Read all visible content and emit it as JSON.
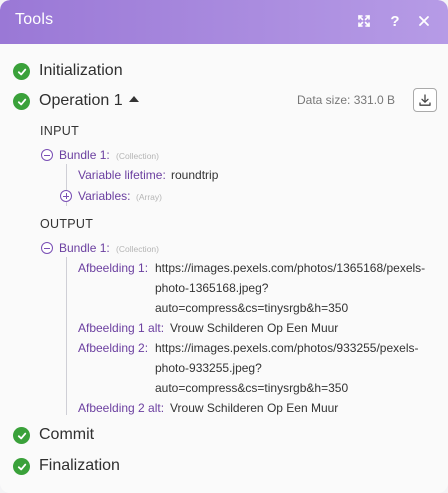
{
  "window": {
    "title": "Tools",
    "buttons": {
      "expand_icon": "expand-icon",
      "help_label": "?",
      "close_icon": "close-icon"
    }
  },
  "colors": {
    "header_start": "#9a78d6",
    "header_end": "#b69be6",
    "success": "#3aa13a",
    "key": "#6b3fa0"
  },
  "stages": [
    {
      "label": "Initialization",
      "status": "success"
    },
    {
      "label": "Operation 1",
      "status": "success",
      "expanded": true
    },
    {
      "label": "Commit",
      "status": "success"
    },
    {
      "label": "Finalization",
      "status": "success"
    }
  ],
  "operation": {
    "data_size": "Data size: 331.0 B",
    "download_icon": "download-icon",
    "input": {
      "heading": "INPUT",
      "bundle_label": "Bundle 1:",
      "bundle_type": "(Collection)",
      "fields": [
        {
          "key": "Variable lifetime:",
          "value": "roundtrip"
        }
      ],
      "variables_label": "Variables:",
      "variables_type": "(Array)"
    },
    "output": {
      "heading": "OUTPUT",
      "bundle_label": "Bundle 1:",
      "bundle_type": "(Collection)",
      "fields": [
        {
          "key": "Afbeelding 1:",
          "value_lines": [
            "https://images.pexels.com/photos/1365168/pexels-",
            "photo-1365168.jpeg?",
            "auto=compress&cs=tinysrgb&h=350"
          ]
        },
        {
          "key": "Afbeelding 1 alt:",
          "value_lines": [
            "Vrouw Schilderen Op Een Muur"
          ]
        },
        {
          "key": "Afbeelding 2:",
          "value_lines": [
            "https://images.pexels.com/photos/933255/pexels-",
            "photo-933255.jpeg?",
            "auto=compress&cs=tinysrgb&h=350"
          ]
        },
        {
          "key": "Afbeelding 2 alt:",
          "value_lines": [
            "Vrouw Schilderen Op Een Muur"
          ]
        }
      ]
    }
  }
}
